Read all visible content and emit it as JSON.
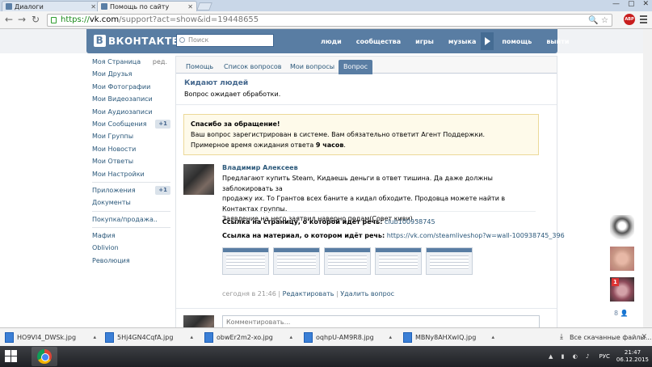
{
  "browser": {
    "tabs": [
      {
        "title": "Диалоги",
        "active": false
      },
      {
        "title": "Помощь по сайту",
        "active": true
      }
    ],
    "url_scheme": "https://",
    "url_host": "vk.com",
    "url_path": "/support?act=show&id=19448655",
    "adblock_label": "ABP"
  },
  "vk": {
    "logo_text": "ВКОНТАКТЕ",
    "logo_letter": "В",
    "search_placeholder": "Поиск",
    "nav": [
      "люди",
      "сообщества",
      "игры",
      "музыка",
      "помощь",
      "выйти"
    ]
  },
  "left_menu": {
    "items": [
      {
        "label": "Моя Страница",
        "extra": "ред."
      },
      {
        "label": "Мои Друзья"
      },
      {
        "label": "Мои Фотографии"
      },
      {
        "label": "Мои Видеозаписи"
      },
      {
        "label": "Мои Аудиозаписи"
      },
      {
        "label": "Мои Сообщения",
        "badge": "+1"
      },
      {
        "label": "Мои Группы"
      },
      {
        "label": "Мои Новости"
      },
      {
        "label": "Мои Ответы"
      },
      {
        "label": "Мои Настройки"
      }
    ],
    "apps": [
      {
        "label": "Приложения",
        "badge": "+1"
      },
      {
        "label": "Документы"
      }
    ],
    "groups1": [
      {
        "label": "Покупка/продажа.."
      }
    ],
    "groups2": [
      {
        "label": "Мафия"
      },
      {
        "label": "Oblivion"
      },
      {
        "label": "Революция"
      }
    ]
  },
  "support": {
    "tabs": [
      "Помощь",
      "Список вопросов",
      "Мои вопросы",
      "Вопрос"
    ],
    "active_tab": 3,
    "question_title": "Кидают людей",
    "question_status": "Вопрос ожидает обработки.",
    "notice_title": "Спасибо за обращение!",
    "notice_line1": "Ваш вопрос зарегистрирован в системе. Вам обязательно ответит Агент Поддержки.",
    "notice_line2_prefix": "Примерное время ожидания ответа ",
    "notice_line2_bold": "9 часов",
    "notice_line2_suffix": ".",
    "author": "Владимир Алексеев",
    "message_line1": "Предлагают купить Steam, Кидаешь деньги в ответ тишина. Да даже должны заблокировать за",
    "message_line2": "продажу их. То Грантов всех баните а кидал обходите. Продовца можете найти в Контактах группы.",
    "message_line3": "Заявление на него заятвил наверно подам(Совет киви) .",
    "page_link_label": "Ссылка на страницу, о которой идёт речь:",
    "page_link_value": "club100938745",
    "material_link_label": "Ссылка на материал, о котором идёт речь:",
    "material_link_value": "https://vk.com/steamliveshop?w=wall-100938745_396",
    "attachments_count": 5,
    "time": "сегодня в 21:46",
    "sep": "|",
    "edit_label": "Редактировать",
    "delete_label": "Удалить вопрос",
    "comment_placeholder": "Комментировать..."
  },
  "sidebar_right": {
    "unread_badge": "1",
    "online_count": "8"
  },
  "downloads": {
    "files": [
      "HO9VI4_DWSk.jpg",
      "5Hj4GN4CqfA.jpg",
      "obwEr2m2-xo.jpg",
      "oqhpU-AM9R8.jpg",
      "MBNy8AHXwIQ.jpg"
    ],
    "show_all": "Все скачанные файлы..."
  },
  "taskbar": {
    "lang": "РУС",
    "time": "21:47",
    "date": "06.12.2015"
  }
}
